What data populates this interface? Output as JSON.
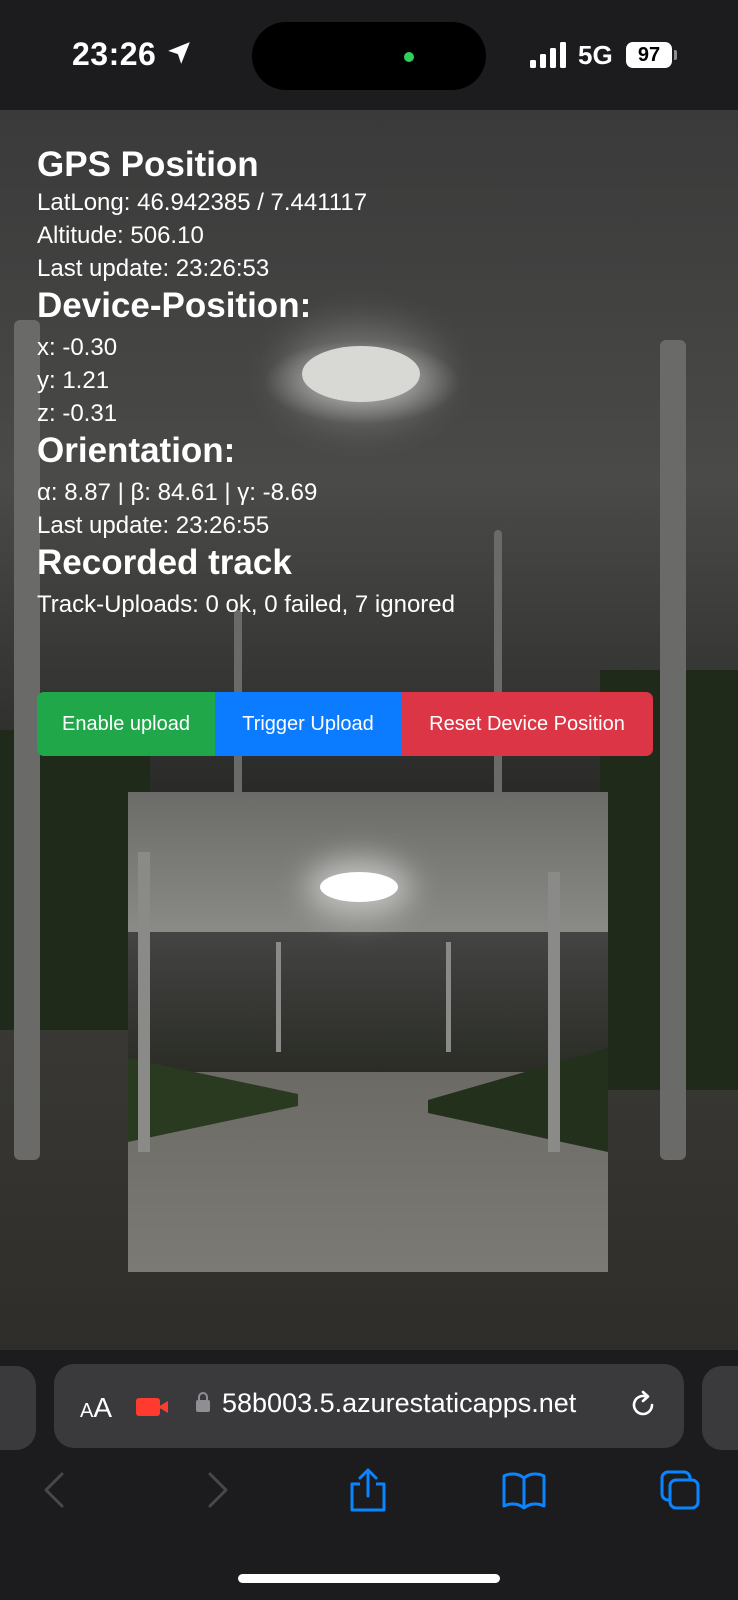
{
  "status_bar": {
    "time": "23:26",
    "network": "5G",
    "battery": "97"
  },
  "gps": {
    "heading": "GPS Position",
    "latlong": "LatLong: 46.942385 / 7.441117",
    "altitude": "Altitude: 506.10",
    "last_update": "Last update: 23:26:53"
  },
  "device_position": {
    "heading": "Device-Position:",
    "x": "x: -0.30",
    "y": "y: 1.21",
    "z": "z: -0.31"
  },
  "orientation": {
    "heading": "Orientation:",
    "angles": "α: 8.87 | β: 84.61 | γ: -8.69",
    "last_update": "Last update: 23:26:55"
  },
  "track": {
    "heading": "Recorded track",
    "uploads": "Track-Uploads: 0 ok, 0 failed, 7 ignored"
  },
  "buttons": {
    "enable_upload": "Enable upload",
    "trigger_upload": "Trigger Upload",
    "reset_position": "Reset Device Position"
  },
  "browser": {
    "aa_small": "A",
    "aa_large": "A",
    "url": "58b003.5.azurestaticapps.net"
  },
  "colors": {
    "enable_upload": "#1fa74a",
    "trigger_upload": "#0b7cff",
    "reset_position": "#dc3545",
    "toolbar_icons": "#0a84ff"
  }
}
